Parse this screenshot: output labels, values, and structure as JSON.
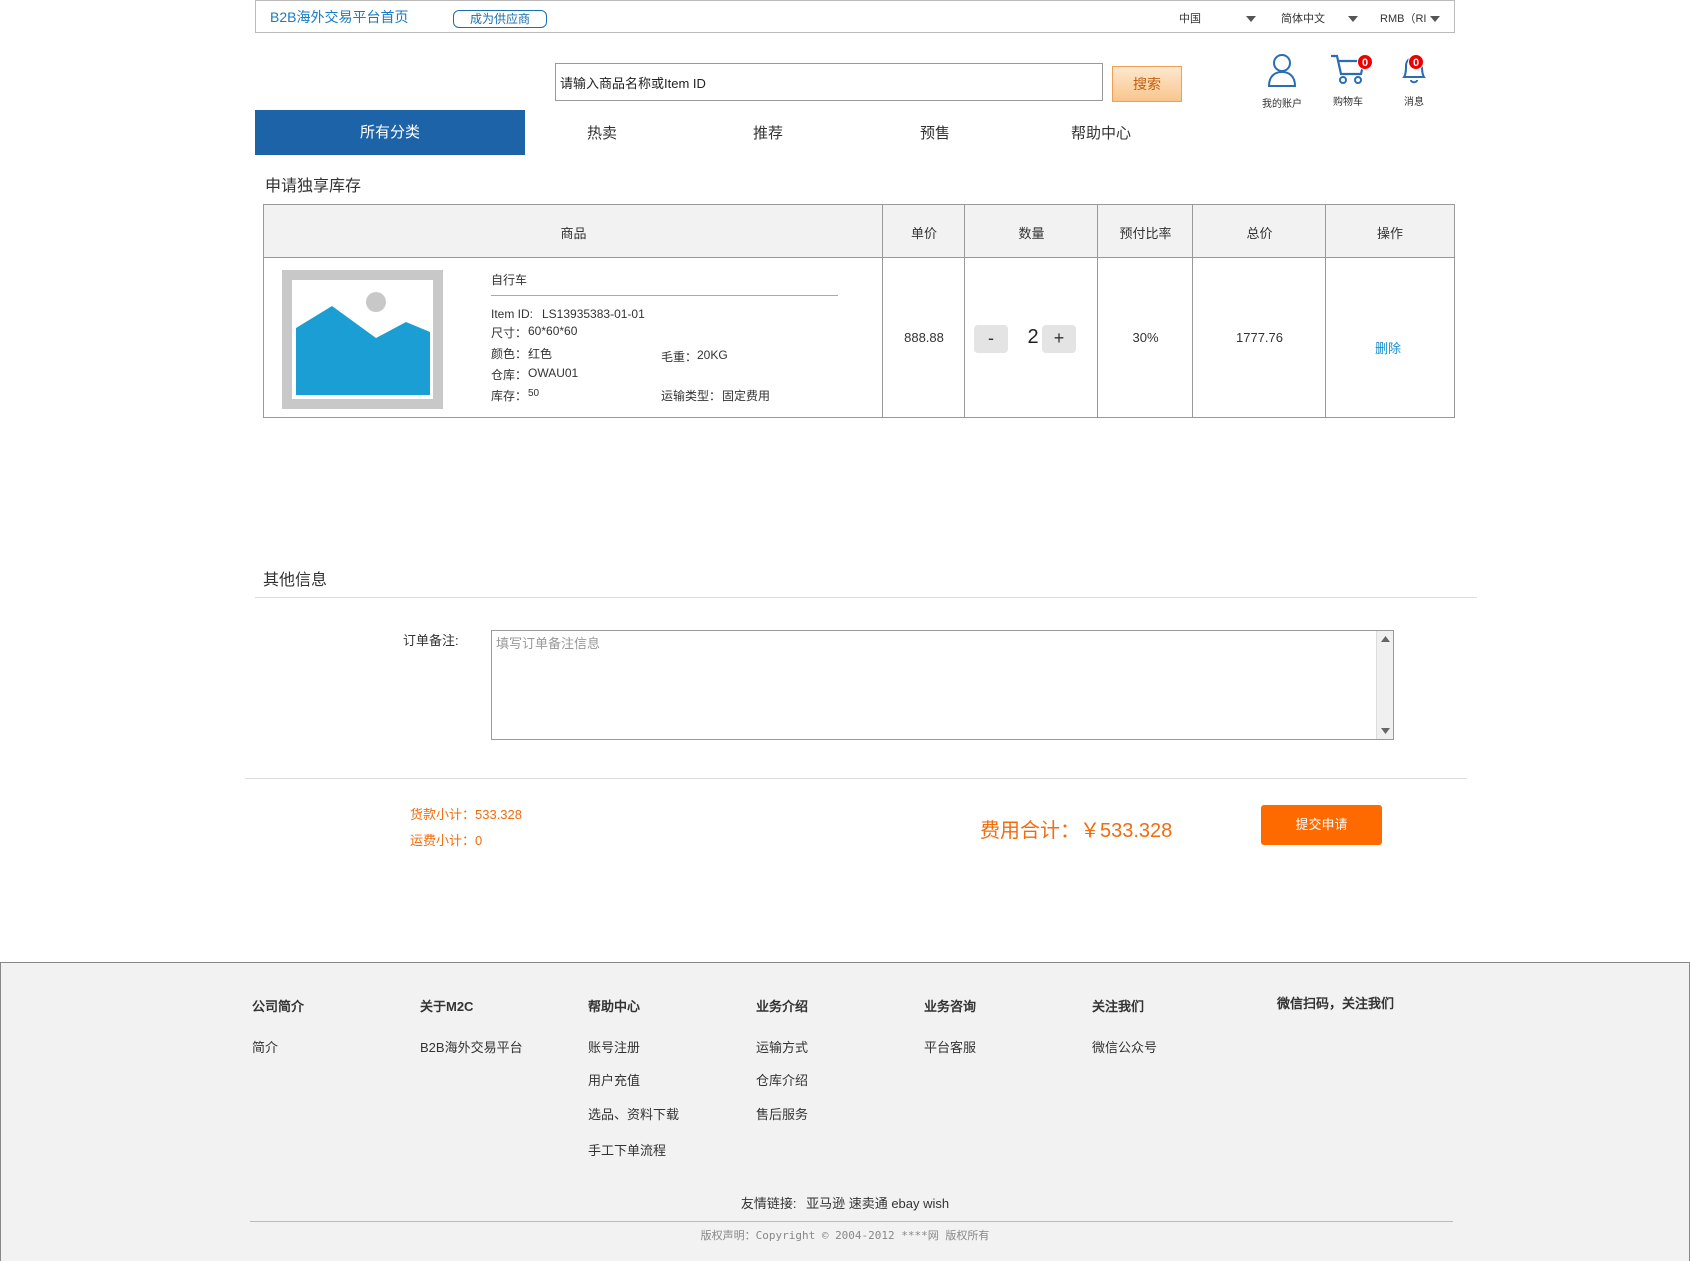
{
  "topbar": {
    "home_link": "B2B海外交易平台首页",
    "become_supplier": "成为供应商",
    "country": "中国",
    "language": "简体中文",
    "currency": "RMB（RI"
  },
  "search": {
    "placeholder": "请输入商品名称或Item ID",
    "button": "搜索"
  },
  "header_icons": {
    "account": "我的账户",
    "cart": "购物车",
    "cart_count": "0",
    "messages": "消息",
    "message_count": "0"
  },
  "nav": {
    "all": "所有分类",
    "items": [
      "热卖",
      "推荐",
      "预售",
      "帮助中心"
    ]
  },
  "section1": {
    "title": "申请独享库存"
  },
  "table": {
    "headers": [
      "商品",
      "单价",
      "数量",
      "预付比率",
      "总价",
      "操作"
    ],
    "row": {
      "name": "自行车",
      "item_id_label": "Item ID:",
      "item_id": "LS13935383-01-01",
      "size_label": "尺寸：",
      "size": "60*60*60",
      "color_label": "颜色：",
      "color": "红色",
      "weight_label": "毛重：",
      "weight": "20KG",
      "warehouse_label": "仓库：",
      "warehouse": "OWAU01",
      "stock_label": "库存：",
      "stock": "50",
      "shipping_label": "运输类型：",
      "shipping": "固定费用",
      "unit_price": "888.88",
      "qty_minus": "-",
      "qty": "2",
      "qty_plus": "+",
      "prepay": "30%",
      "total": "1777.76",
      "delete": "删除"
    }
  },
  "section2": {
    "title": "其他信息",
    "remark_label": "订单备注:",
    "remark_placeholder": "填写订单备注信息"
  },
  "summary": {
    "goods_subtotal": "货款小计：533.328",
    "freight_subtotal": "运费小计：0",
    "total": "费用合计：￥533.328",
    "submit": "提交申请"
  },
  "footer": {
    "columns": [
      {
        "title": "公司简介",
        "links": [
          "简介"
        ]
      },
      {
        "title": "关于M2C",
        "links": [
          "B2B海外交易平台"
        ]
      },
      {
        "title": "帮助中心",
        "links": [
          "账号注册",
          "用户充值",
          "选品、资料下载",
          "手工下单流程"
        ]
      },
      {
        "title": "业务介绍",
        "links": [
          "运输方式",
          "仓库介绍",
          "售后服务"
        ]
      },
      {
        "title": "业务咨询",
        "links": [
          "平台客服"
        ]
      },
      {
        "title": "关注我们",
        "links": [
          "微信公众号"
        ]
      }
    ],
    "wechat": "微信扫码，关注我们",
    "friend_links_label": "友情链接:",
    "friend_links": "亚马逊 速卖通 ebay wish",
    "copyright": "版权声明：Copyright © 2004-2012  ****网 版权所有"
  }
}
